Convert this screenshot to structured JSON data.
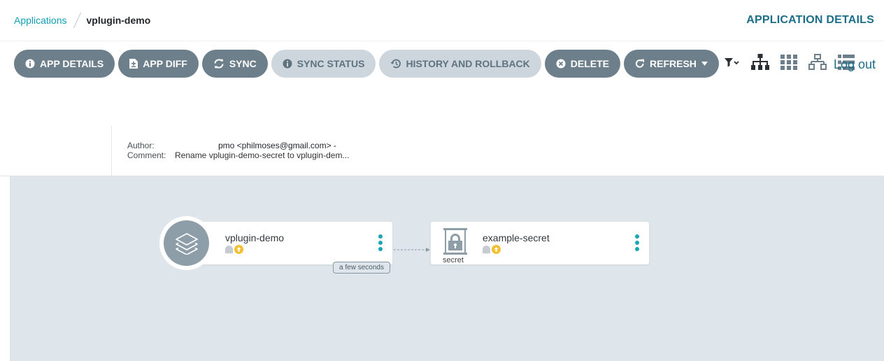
{
  "breadcrumb": {
    "root": "Applications",
    "current": "vplugin-demo"
  },
  "header": {
    "title": "APPLICATION DETAILS",
    "logout": "Log out"
  },
  "toolbar": {
    "buttons": [
      {
        "label": "APP DETAILS",
        "icon": "info-circle-icon",
        "enabled": true
      },
      {
        "label": "APP DIFF",
        "icon": "file-diff-icon",
        "enabled": true
      },
      {
        "label": "SYNC",
        "icon": "sync-icon",
        "enabled": true
      },
      {
        "label": "SYNC STATUS",
        "icon": "info-circle-icon",
        "enabled": false
      },
      {
        "label": "HISTORY AND ROLLBACK",
        "icon": "history-icon",
        "enabled": false
      },
      {
        "label": "DELETE",
        "icon": "times-circle-icon",
        "enabled": true
      },
      {
        "label": "REFRESH",
        "icon": "redo-icon",
        "enabled": true,
        "dropdown": true
      }
    ],
    "view_icons": [
      "filter-icon",
      "tree-view-icon",
      "pods-view-icon",
      "network-view-icon",
      "list-view-icon"
    ]
  },
  "revision": {
    "author_label": "Author:",
    "author_value": "pmo <philmoses@gmail.com> -",
    "comment_label": "Comment:",
    "comment_value": "Rename vplugin-demo-secret to vplugin-dem..."
  },
  "graph": {
    "app_node": {
      "name": "vplugin-demo",
      "health_icon": "missing-ghost-icon",
      "sync_icon": "out-of-sync-icon"
    },
    "edge_label": "a few seconds",
    "secret_node": {
      "name": "example-secret",
      "kind": "secret",
      "health_icon": "missing-ghost-icon",
      "sync_icon": "out-of-sync-icon"
    }
  },
  "colors": {
    "accent": "#11a0b5",
    "button": "#6d7f8b",
    "button_disabled": "#cdd6dc",
    "canvas": "#dee6eb",
    "out_of_sync": "#f4c030"
  }
}
